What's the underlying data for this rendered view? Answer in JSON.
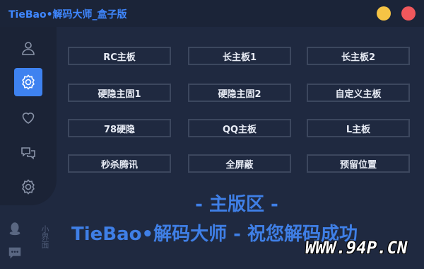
{
  "window": {
    "title": "TieBao•解码大师_盒子版",
    "minimize_color": "#f6c445",
    "close_color": "#f0585c"
  },
  "sidebar": {
    "items": [
      {
        "icon": "user-icon",
        "active": false
      },
      {
        "icon": "settings-icon",
        "active": true
      },
      {
        "icon": "heart-icon",
        "active": false
      },
      {
        "icon": "chat-icon",
        "active": false
      },
      {
        "icon": "settings-icon",
        "active": false
      }
    ],
    "footer_text": "小界面",
    "footer_icons": [
      "qq-penguin-icon",
      "message-icon"
    ]
  },
  "buttons": [
    [
      "RC主板",
      "长主板1",
      "长主板2"
    ],
    [
      "硬隐主固1",
      "硬隐主固2",
      "自定义主板"
    ],
    [
      "78硬隐",
      "QQ主板",
      "L主板"
    ],
    [
      "秒杀腾讯",
      "全屏蔽",
      "预留位置"
    ]
  ],
  "main": {
    "heading": "- 主版区 -",
    "slogan": "TieBao•解码大师 - 祝您解码成功"
  },
  "watermark": "WWW.94P.CN",
  "colors": {
    "accent": "#3e82f0",
    "title_text": "#3f87ff",
    "background": "#1f2940"
  }
}
